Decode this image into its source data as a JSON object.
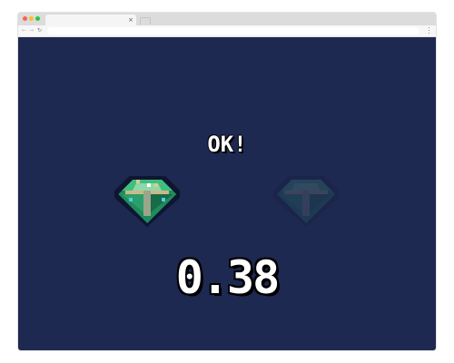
{
  "browser": {
    "tab_close_glyph": "×",
    "back_glyph": "←",
    "forward_glyph": "→",
    "reload_glyph": "↻"
  },
  "game": {
    "status_text": "OK!",
    "score": "0.38",
    "background_color": "#1e2952",
    "gems": [
      {
        "name": "gem-collected",
        "state": "active",
        "color": "#2aa86a"
      },
      {
        "name": "gem-missing",
        "state": "faded",
        "color": "#2aa86a"
      }
    ]
  }
}
